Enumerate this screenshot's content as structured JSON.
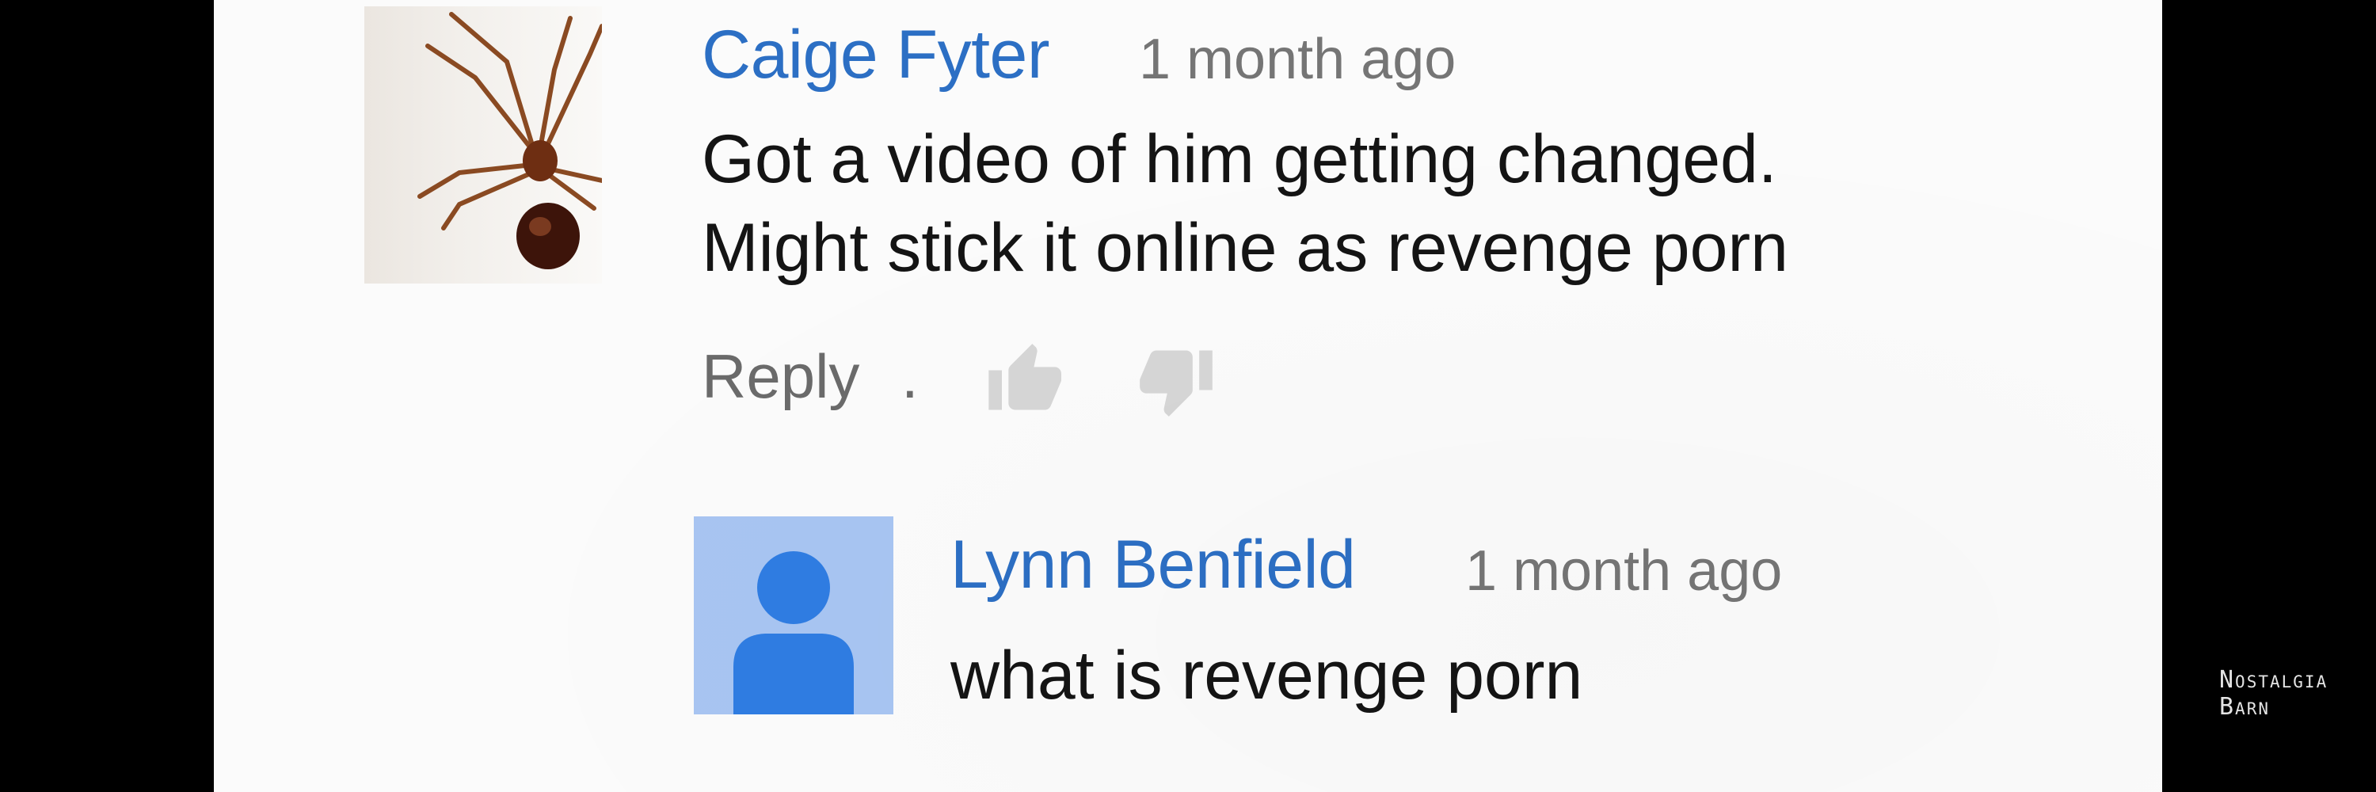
{
  "comments": [
    {
      "author": "Caige Fyter",
      "time": "1 month ago",
      "lines": [
        "Got a video of him getting changed.",
        "Might stick it online as revenge porn"
      ],
      "avatar": "spider-photo",
      "actions": {
        "reply_label": "Reply",
        "separator": ".",
        "like_icon": "thumbs-up-icon",
        "dislike_icon": "thumbs-down-icon"
      }
    },
    {
      "author": "Lynn Benfield",
      "time": "1 month ago",
      "lines": [
        "what is revenge porn"
      ],
      "avatar": "default-user-icon"
    }
  ],
  "watermark": {
    "line1": "Nostalgia",
    "line2": "Barn"
  },
  "colors": {
    "author": "#2c6fc4",
    "avatar_bg": "#a8c5f2",
    "avatar_fg": "#2f7de2",
    "background": "#fbfbfb"
  }
}
